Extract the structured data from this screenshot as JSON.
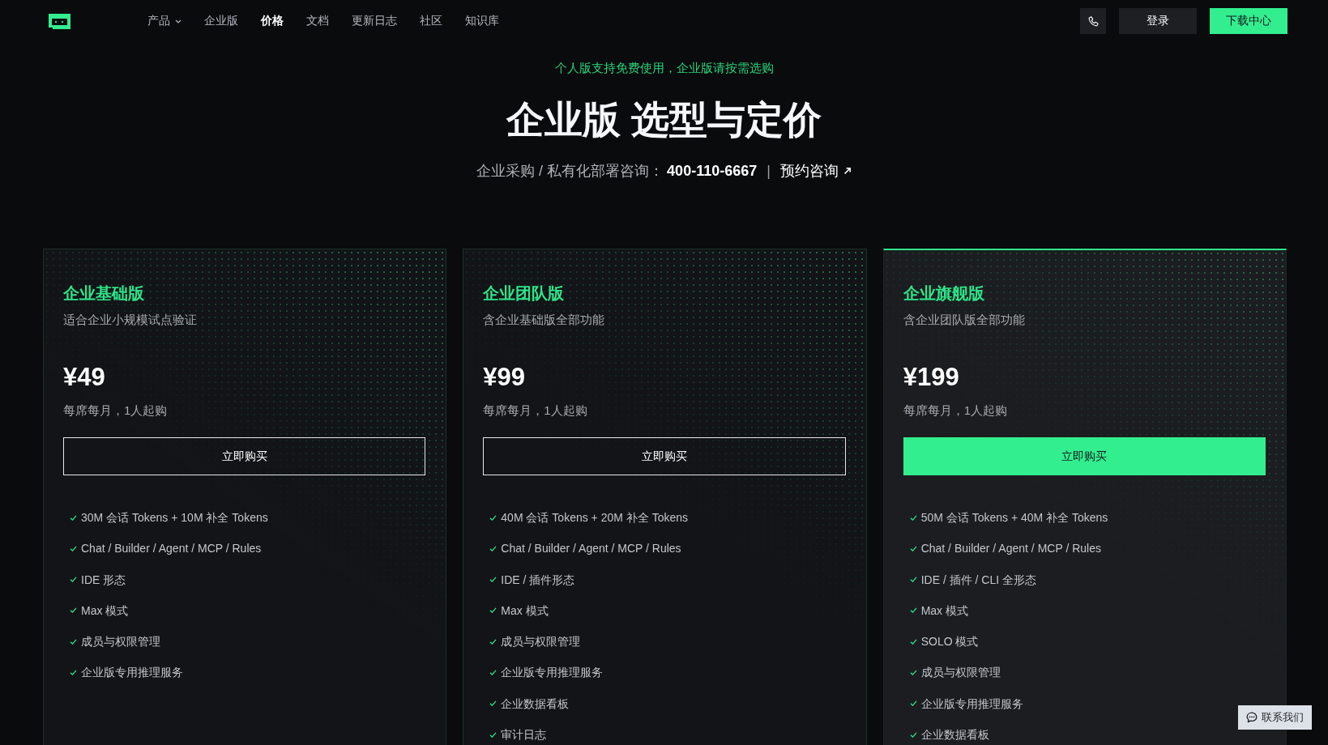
{
  "nav": {
    "items": [
      {
        "label": "产品",
        "kind": "dropdown",
        "selected": false
      },
      {
        "label": "企业版",
        "kind": "link",
        "selected": false
      },
      {
        "label": "价格",
        "kind": "link",
        "selected": true
      },
      {
        "label": "文档",
        "kind": "link",
        "selected": false
      },
      {
        "label": "更新日志",
        "kind": "link",
        "selected": false
      },
      {
        "label": "社区",
        "kind": "link",
        "selected": false
      },
      {
        "label": "知识库",
        "kind": "link",
        "selected": false
      }
    ],
    "actions": [
      {
        "kind": "phone"
      },
      {
        "kind": "login",
        "label": "登录"
      },
      {
        "kind": "download",
        "label": "下载中心"
      }
    ]
  },
  "hero": {
    "eyebrow": "个人版支持免费使用，企业版请按需选购",
    "title": "企业版 选型与定价",
    "contact_label": "企业采购 / 私有化部署咨询：",
    "phone": "400-110-6667",
    "separator": "|",
    "link": "预约咨询"
  },
  "plans": [
    {
      "name": "企业基础版",
      "description": "适合企业小规模试点验证",
      "price": "¥49",
      "price_note": "每席每月，1人起购",
      "button": "立即购买",
      "featured": false,
      "features": [
        "30M 会话 Tokens + 10M 补全 Tokens",
        "Chat / Builder / Agent / MCP / Rules",
        "IDE 形态",
        "Max 模式",
        "成员与权限管理",
        "企业版专用推理服务"
      ]
    },
    {
      "name": "企业团队版",
      "description": "含企业基础版全部功能",
      "price": "¥99",
      "price_note": "每席每月，1人起购",
      "button": "立即购买",
      "featured": false,
      "features": [
        "40M 会话 Tokens + 20M 补全 Tokens",
        "Chat / Builder / Agent / MCP / Rules",
        "IDE / 插件形态",
        "Max 模式",
        "成员与权限管理",
        "企业版专用推理服务",
        "企业数据看板",
        "审计日志"
      ]
    },
    {
      "name": "企业旗舰版",
      "description": "含企业团队版全部功能",
      "price": "¥199",
      "price_note": "每席每月，1人起购",
      "button": "立即购买",
      "featured": true,
      "features": [
        "50M 会话 Tokens + 40M 补全 Tokens",
        "Chat / Builder / Agent / MCP / Rules",
        "IDE / 插件 / CLI 全形态",
        "Max 模式",
        "SOLO 模式",
        "成员与权限管理",
        "企业版专用推理服务",
        "企业数据看板"
      ]
    }
  ],
  "chat_button": {
    "label": "联系我们"
  }
}
